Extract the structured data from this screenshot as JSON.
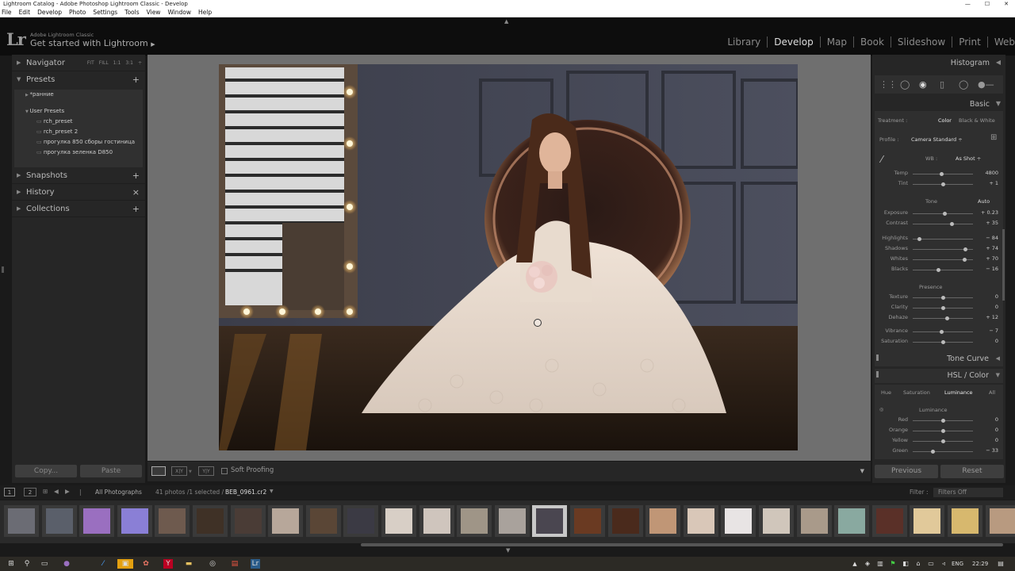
{
  "window": {
    "title": "Lightroom Catalog - Adobe Photoshop Lightroom Classic - Develop",
    "controls": [
      "—",
      "☐",
      "✕"
    ]
  },
  "menu": [
    "File",
    "Edit",
    "Develop",
    "Photo",
    "Settings",
    "Tools",
    "View",
    "Window",
    "Help"
  ],
  "identity": {
    "logo": "Lr",
    "app_name": "Adobe Lightroom Classic",
    "get_started": "Get started with Lightroom"
  },
  "modules": [
    "Library",
    "Develop",
    "Map",
    "Book",
    "Slideshow",
    "Print",
    "Web"
  ],
  "left_panel": {
    "navigator": {
      "label": "Navigator",
      "options": [
        "FIT",
        "FILL",
        "1:1",
        "3:1"
      ]
    },
    "presets": {
      "label": "Presets",
      "items": [
        {
          "label": "*ранние",
          "indent": 1
        },
        {
          "label": "User Presets",
          "indent": 1
        },
        {
          "label": "rch_preset",
          "indent": 2
        },
        {
          "label": "rch_preset 2",
          "indent": 2
        },
        {
          "label": "прогулка 850 сборы гостиница",
          "indent": 2
        },
        {
          "label": "прогулка зеленка D850",
          "indent": 2
        }
      ]
    },
    "snapshots": "Snapshots",
    "history": "History",
    "collections": "Collections",
    "copy_button": "Copy...",
    "paste_button": "Paste"
  },
  "toolbar": {
    "soft_proofing": "Soft Proofing"
  },
  "right_panel": {
    "histogram": "Histogram",
    "basic": "Basic",
    "treatment_label": "Treatment :",
    "treatment_color": "Color",
    "treatment_bw": "Black & White",
    "profile_label": "Profile :",
    "profile_value": "Camera Standard ÷",
    "wb_label": "WB :",
    "wb_value": "As Shot ÷",
    "tone_label": "Tone",
    "tone_auto": "Auto",
    "presence_label": "Presence",
    "sliders": [
      {
        "label": "Temp",
        "value": "4800",
        "pos": 0.48
      },
      {
        "label": "Tint",
        "value": "+ 1",
        "pos": 0.5
      },
      {
        "label": "Exposure",
        "value": "+ 0.23",
        "pos": 0.52
      },
      {
        "label": "Contrast",
        "value": "+ 35",
        "pos": 0.64
      },
      {
        "label": "Highlights",
        "value": "− 84",
        "pos": 0.1
      },
      {
        "label": "Shadows",
        "value": "+ 74",
        "pos": 0.87
      },
      {
        "label": "Whites",
        "value": "+ 70",
        "pos": 0.85
      },
      {
        "label": "Blacks",
        "value": "− 16",
        "pos": 0.42
      },
      {
        "label": "Texture",
        "value": "0",
        "pos": 0.5
      },
      {
        "label": "Clarity",
        "value": "0",
        "pos": 0.5
      },
      {
        "label": "Dehaze",
        "value": "+ 12",
        "pos": 0.56
      },
      {
        "label": "Vibrance",
        "value": "− 7",
        "pos": 0.47
      },
      {
        "label": "Saturation",
        "value": "0",
        "pos": 0.5
      }
    ],
    "tone_curve": "Tone Curve",
    "hsl": "HSL / Color",
    "hsl_tabs": [
      "Hue",
      "Saturation",
      "Luminance",
      "All"
    ],
    "luminance_label": "Luminance",
    "hsl_sliders": [
      {
        "label": "Red",
        "value": "0",
        "pos": 0.5
      },
      {
        "label": "Orange",
        "value": "0",
        "pos": 0.5
      },
      {
        "label": "Yellow",
        "value": "0",
        "pos": 0.5
      },
      {
        "label": "Green",
        "value": "− 33",
        "pos": 0.33
      }
    ],
    "previous_button": "Previous",
    "reset_button": "Reset"
  },
  "filmstrip": {
    "source": "All Photographs",
    "info": "41 photos /1 selected /",
    "filename": "BEB_0961.cr2",
    "filter_label": "Filter :",
    "filter_value": "Filters Off",
    "page_buttons": [
      "1",
      "2"
    ],
    "thumbnails": [
      {
        "color": "#6b6c74"
      },
      {
        "color": "#5a5f6a"
      },
      {
        "color": "#9a6fc0"
      },
      {
        "color": "#8a7fd6"
      },
      {
        "color": "#6e5a4e"
      },
      {
        "color": "#3f3126"
      },
      {
        "color": "#4a3c36"
      },
      {
        "color": "#b7a79a"
      },
      {
        "color": "#5a4636"
      },
      {
        "color": "#3b3a44"
      },
      {
        "color": "#d8cfc6"
      },
      {
        "color": "#cfc5bd"
      },
      {
        "color": "#9f9587"
      },
      {
        "color": "#a9a29c"
      },
      {
        "color": "#4a4650"
      },
      {
        "color": "#6a3a22"
      },
      {
        "color": "#4a2a1c"
      },
      {
        "color": "#c09676"
      },
      {
        "color": "#d9c7b8"
      },
      {
        "color": "#e8e4e4"
      },
      {
        "color": "#d0c6bb"
      },
      {
        "color": "#a99a8a"
      },
      {
        "color": "#89a9a0"
      },
      {
        "color": "#5a3028"
      },
      {
        "color": "#e1c99a"
      },
      {
        "color": "#d7b86e"
      },
      {
        "color": "#b89a80"
      }
    ]
  },
  "taskbar": {
    "lang": "ENG",
    "time": "22:29"
  }
}
